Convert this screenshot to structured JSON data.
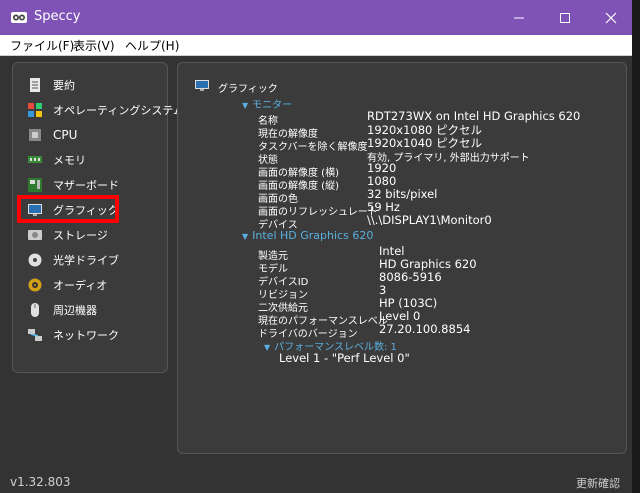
{
  "window": {
    "title": "Speccy",
    "controls": [
      "minimize-icon",
      "maximize-icon",
      "close-icon"
    ],
    "accent": "#7e53b5"
  },
  "menu": [
    "ファイル(F)",
    "表示(V)",
    "ヘルプ(H)"
  ],
  "sidebar": {
    "items": [
      {
        "label": "要約",
        "icon": "summary-icon"
      },
      {
        "label": "オペレーティングシステム",
        "icon": "windows-icon"
      },
      {
        "label": "CPU",
        "icon": "cpu-icon"
      },
      {
        "label": "メモリ",
        "icon": "ram-icon"
      },
      {
        "label": "マザーボード",
        "icon": "motherboard-icon"
      },
      {
        "label": "グラフィック",
        "icon": "monitor-icon"
      },
      {
        "label": "ストレージ",
        "icon": "hdd-icon"
      },
      {
        "label": "光学ドライブ",
        "icon": "disc-icon"
      },
      {
        "label": "オーディオ",
        "icon": "speaker-icon"
      },
      {
        "label": "周辺機器",
        "icon": "mouse-icon"
      },
      {
        "label": "ネットワーク",
        "icon": "network-icon"
      }
    ],
    "highlight_color": "#ff0000"
  },
  "detail": {
    "section_title": "グラフィック",
    "monitor_heading": "モニター",
    "monitor_props": [
      {
        "label": "名称",
        "value": "RDT273WX on Intel HD Graphics 620"
      },
      {
        "label": "現在の解像度",
        "value": "1920x1080 ピクセル"
      },
      {
        "label": "タスクバーを除く解像度",
        "value": "1920x1040 ピクセル"
      },
      {
        "label": "状態",
        "value": "有効, プライマリ, 外部出力サポート"
      },
      {
        "label": "画面の解像度 (横)",
        "value": "1920"
      },
      {
        "label": "画面の解像度 (縦)",
        "value": "1080"
      },
      {
        "label": "画面の色",
        "value": "32 bits/pixel"
      },
      {
        "label": "画面のリフレッシュレート",
        "value": "59 Hz"
      },
      {
        "label": "デバイス",
        "value": "\\\\.\\DISPLAY1\\Monitor0"
      }
    ],
    "gpu_heading": "Intel HD Graphics 620",
    "gpu_props": [
      {
        "label": "製造元",
        "value": "Intel"
      },
      {
        "label": "モデル",
        "value": "HD Graphics 620"
      },
      {
        "label": "デバイスID",
        "value": "8086-5916"
      },
      {
        "label": "リビジョン",
        "value": "3"
      },
      {
        "label": "二次供給元",
        "value": "HP (103C)"
      },
      {
        "label": "現在のパフォーマンスレベル",
        "value": "Level 0"
      },
      {
        "label": "ドライバのバージョン",
        "value": "27.20.100.8854"
      }
    ],
    "perf_heading": "パフォーマンスレベル数: 1",
    "perf_item": "Level 1 - \"Perf Level 0\""
  },
  "status": {
    "version": "v1.32.803",
    "update": "更新確認"
  }
}
